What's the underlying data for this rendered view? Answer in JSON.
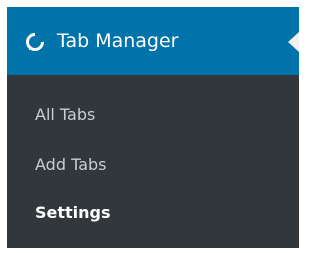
{
  "menu": {
    "title": "Tab Manager",
    "icon": "tab-manager-icon",
    "colors": {
      "head_bg": "#0073aa",
      "sidebar_bg": "#23282d",
      "submenu_bg": "#32373c",
      "submenu_text": "#c9cdd1",
      "current_text": "#ffffff"
    },
    "items": [
      {
        "label": "All Tabs",
        "current": false
      },
      {
        "label": "Add Tabs",
        "current": false
      },
      {
        "label": "Settings",
        "current": true
      }
    ]
  }
}
